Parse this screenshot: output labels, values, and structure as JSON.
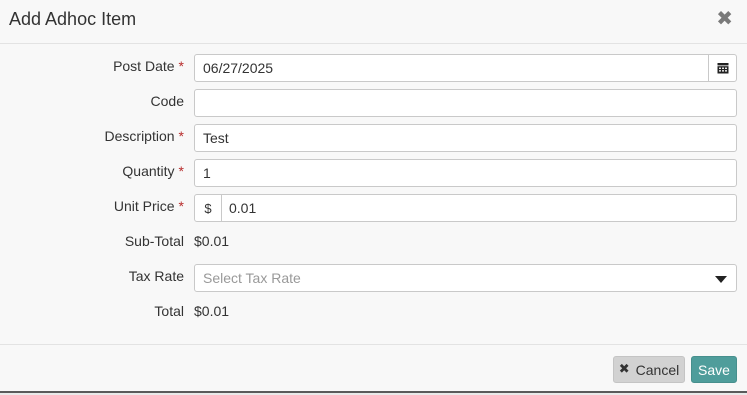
{
  "modal": {
    "title": "Add Adhoc Item",
    "close_glyph": "✖"
  },
  "form": {
    "required_marker": "*",
    "post_date": {
      "label": "Post Date",
      "value": "06/27/2025"
    },
    "code": {
      "label": "Code",
      "value": ""
    },
    "description": {
      "label": "Description",
      "value": "Test"
    },
    "quantity": {
      "label": "Quantity",
      "value": "1"
    },
    "unit_price": {
      "label": "Unit Price",
      "prefix": "$",
      "value": "0.01"
    },
    "sub_total": {
      "label": "Sub-Total",
      "value": "$0.01"
    },
    "tax_rate": {
      "label": "Tax Rate",
      "placeholder": "Select Tax Rate"
    },
    "total": {
      "label": "Total",
      "value": "$0.01"
    }
  },
  "footer": {
    "cancel_label": "Cancel",
    "cancel_glyph": "✖",
    "save_label": "Save"
  },
  "icons": {
    "close": "close-icon",
    "calendar": "calendar-icon",
    "dropdown": "caret-down-icon",
    "cancel": "x-icon"
  },
  "colors": {
    "required": "#b72b2b",
    "save_button": "#4f9d9b",
    "cancel_button": "#d2d2d2"
  }
}
